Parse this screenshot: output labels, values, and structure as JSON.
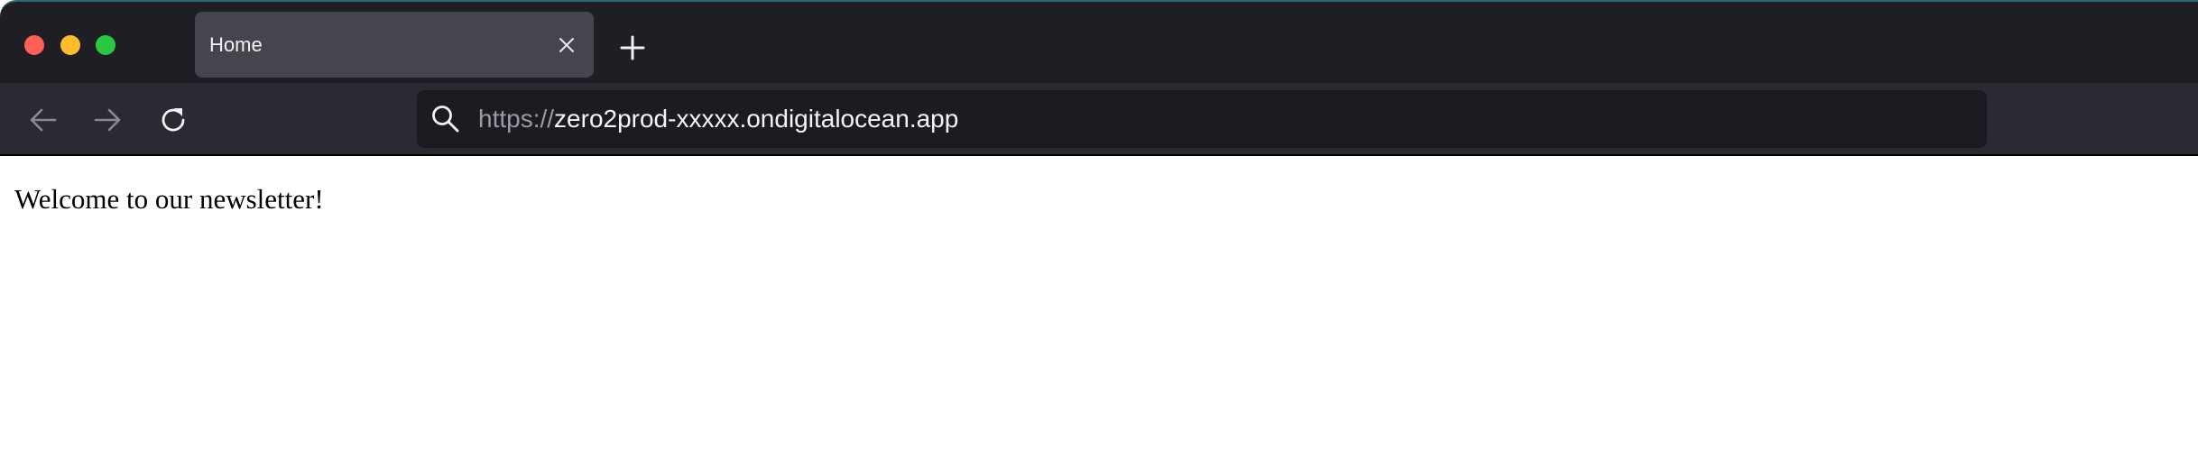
{
  "window": {
    "controls": {
      "close_color": "#fe5f57",
      "minimize_color": "#febc2e",
      "maximize_color": "#28c840"
    }
  },
  "tabs": [
    {
      "title": "Home",
      "active": true,
      "close_icon": "close-icon"
    }
  ],
  "tab_strip": {
    "new_tab_icon": "plus-icon"
  },
  "toolbar": {
    "back_icon": "arrow-left-icon",
    "forward_icon": "arrow-right-icon",
    "reload_icon": "reload-icon",
    "search_icon": "search-icon",
    "url": {
      "scheme": "https://",
      "host": "zero2prod-xxxxx.ondigitalocean.app"
    }
  },
  "page": {
    "welcome_text": "Welcome to our newsletter!"
  },
  "colors": {
    "tab_strip_bg": "#1f1e25",
    "toolbar_bg": "#2b2a33",
    "active_tab_bg": "#46444d",
    "urlbar_bg": "#1c1b22"
  }
}
